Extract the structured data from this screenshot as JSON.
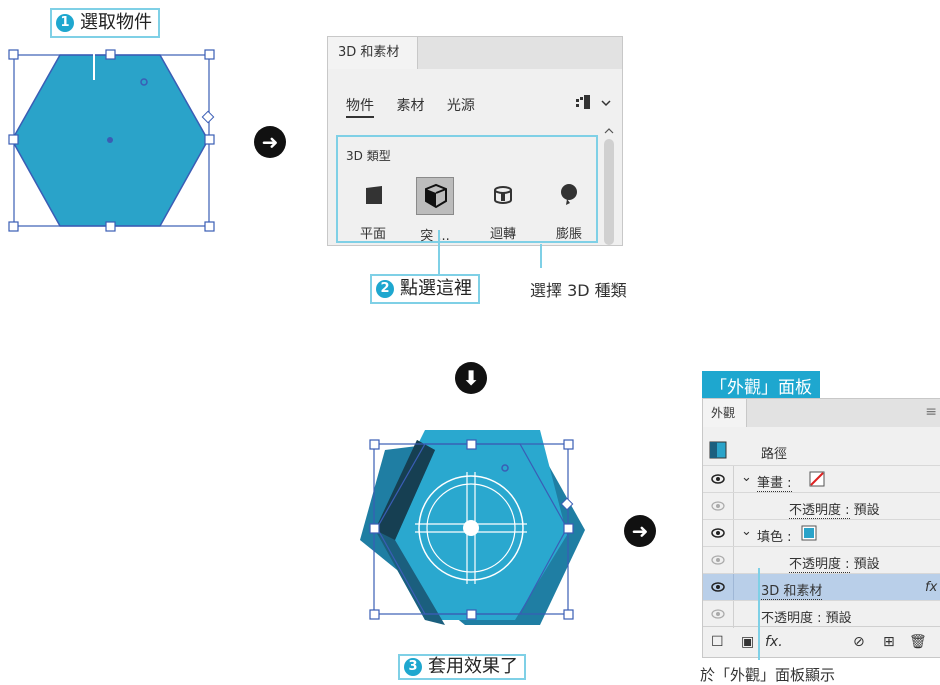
{
  "step1": {
    "number": "1",
    "label": "選取物件"
  },
  "step2": {
    "number": "2",
    "label": "點選這裡"
  },
  "step3": {
    "number": "3",
    "label": "套用效果了"
  },
  "panel3d": {
    "tab": "3D 和素材",
    "subtabs": [
      "物件",
      "素材",
      "光源"
    ],
    "type_label": "3D 類型",
    "types": [
      "平面",
      "突 ...",
      "迴轉",
      "膨脹"
    ],
    "note": "選擇 3D 種類"
  },
  "appearance": {
    "heading": "「外觀」面板",
    "tab": "外觀",
    "rows": [
      {
        "label": "路徑"
      },
      {
        "label": "筆畫 :"
      },
      {
        "label": "不透明度 :",
        "value": "預設"
      },
      {
        "label": "填色 :"
      },
      {
        "label": "不透明度 :",
        "value": "預設"
      },
      {
        "label": "3D 和素材",
        "fx": "fx"
      },
      {
        "label": "不透明度 :",
        "value": "預設"
      }
    ],
    "bottom_fx": "fx.",
    "note": "於「外觀」面板顯示"
  },
  "colors": {
    "accent": "#1ea7cf",
    "shape": "#2aa3c9",
    "highlight": "#b9cfe9"
  },
  "icons": [
    "arrow-right-icon",
    "arrow-down-icon",
    "eye-icon",
    "trash-icon"
  ]
}
